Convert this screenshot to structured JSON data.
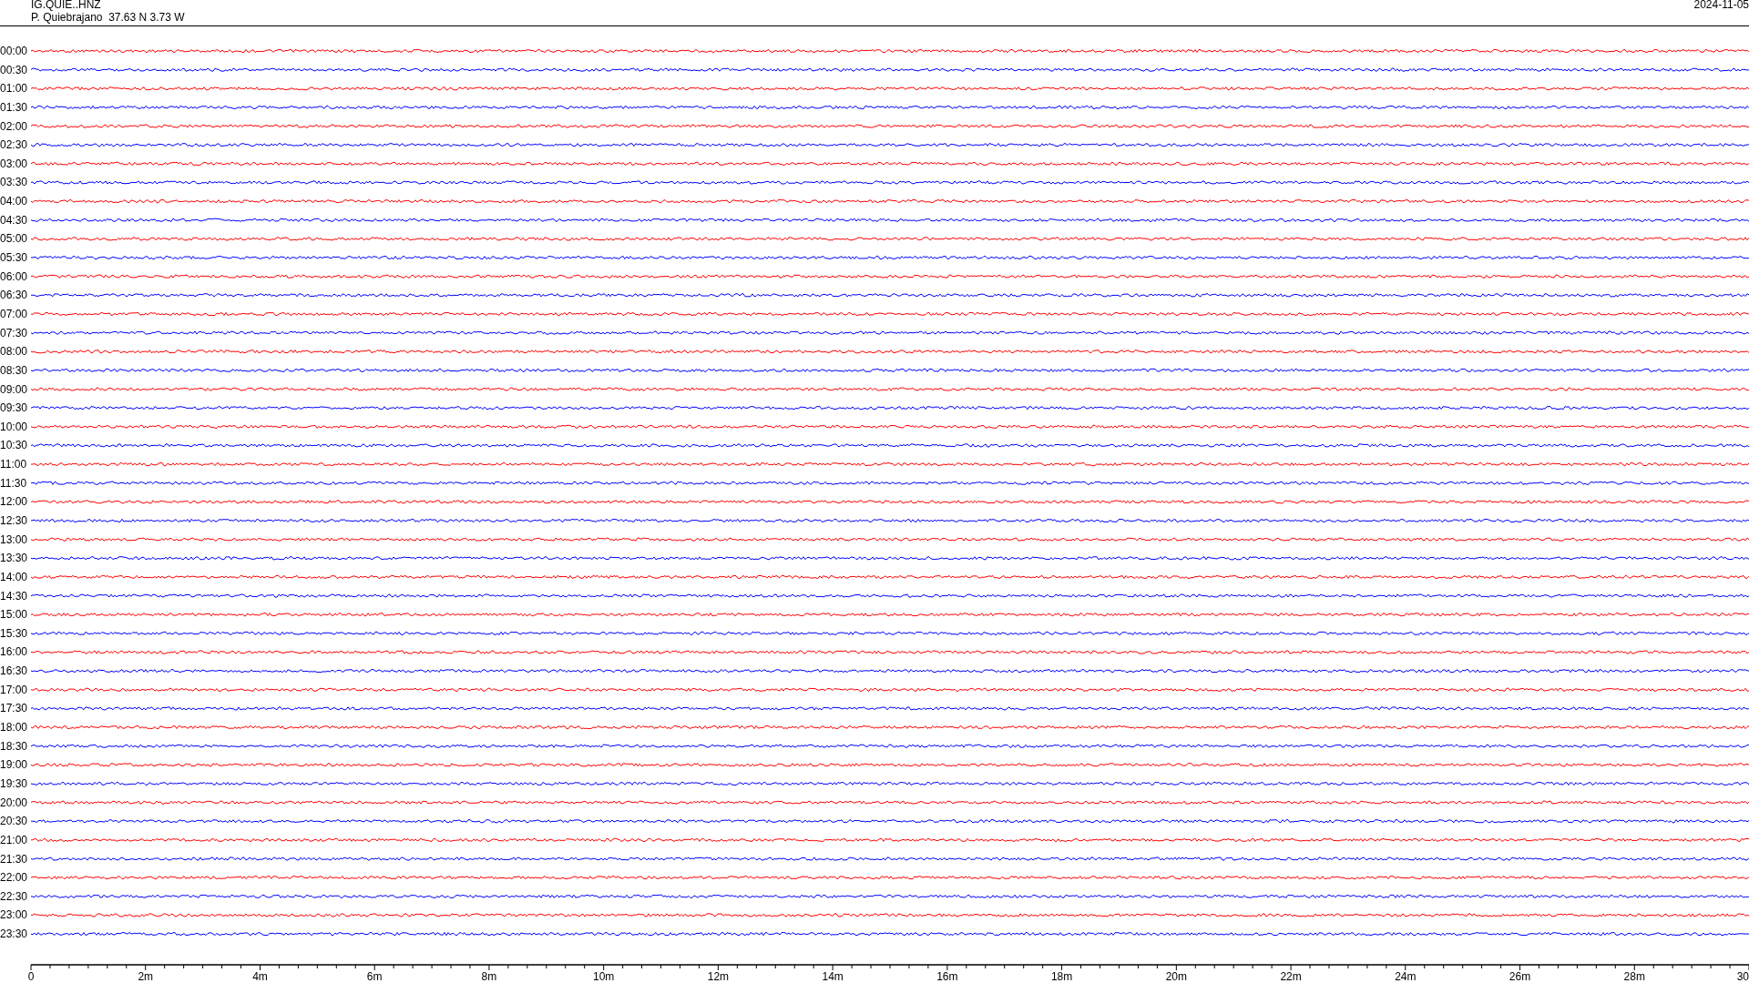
{
  "header": {
    "station": "IG.QUIE..HNZ",
    "location": "P. Quiebrajano  37.63 N 3.73 W",
    "date": "2024-11-05"
  },
  "rows": [
    {
      "label": "00:00",
      "color": "#ff0000"
    },
    {
      "label": "00:30",
      "color": "#0000ff"
    },
    {
      "label": "01:00",
      "color": "#ff0000"
    },
    {
      "label": "01:30",
      "color": "#0000ff"
    },
    {
      "label": "02:00",
      "color": "#ff0000"
    },
    {
      "label": "02:30",
      "color": "#0000ff"
    },
    {
      "label": "03:00",
      "color": "#ff0000"
    },
    {
      "label": "03:30",
      "color": "#0000ff"
    },
    {
      "label": "04:00",
      "color": "#ff0000"
    },
    {
      "label": "04:30",
      "color": "#0000ff"
    },
    {
      "label": "05:00",
      "color": "#ff0000"
    },
    {
      "label": "05:30",
      "color": "#0000ff"
    },
    {
      "label": "06:00",
      "color": "#ff0000"
    },
    {
      "label": "06:30",
      "color": "#0000ff"
    },
    {
      "label": "07:00",
      "color": "#ff0000"
    },
    {
      "label": "07:30",
      "color": "#0000ff"
    },
    {
      "label": "08:00",
      "color": "#ff0000"
    },
    {
      "label": "08:30",
      "color": "#0000ff"
    },
    {
      "label": "09:00",
      "color": "#ff0000"
    },
    {
      "label": "09:30",
      "color": "#0000ff"
    },
    {
      "label": "10:00",
      "color": "#ff0000"
    },
    {
      "label": "10:30",
      "color": "#0000ff"
    },
    {
      "label": "11:00",
      "color": "#ff0000"
    },
    {
      "label": "11:30",
      "color": "#0000ff"
    },
    {
      "label": "12:00",
      "color": "#ff0000"
    },
    {
      "label": "12:30",
      "color": "#0000ff"
    },
    {
      "label": "13:00",
      "color": "#ff0000"
    },
    {
      "label": "13:30",
      "color": "#0000ff"
    },
    {
      "label": "14:00",
      "color": "#ff0000"
    },
    {
      "label": "14:30",
      "color": "#0000ff"
    },
    {
      "label": "15:00",
      "color": "#ff0000"
    },
    {
      "label": "15:30",
      "color": "#0000ff"
    },
    {
      "label": "16:00",
      "color": "#ff0000"
    },
    {
      "label": "16:30",
      "color": "#0000ff"
    },
    {
      "label": "17:00",
      "color": "#ff0000"
    },
    {
      "label": "17:30",
      "color": "#0000ff"
    },
    {
      "label": "18:00",
      "color": "#ff0000"
    },
    {
      "label": "18:30",
      "color": "#0000ff"
    },
    {
      "label": "19:00",
      "color": "#ff0000"
    },
    {
      "label": "19:30",
      "color": "#0000ff"
    },
    {
      "label": "20:00",
      "color": "#ff0000"
    },
    {
      "label": "20:30",
      "color": "#0000ff"
    },
    {
      "label": "21:00",
      "color": "#ff0000"
    },
    {
      "label": "21:30",
      "color": "#0000ff"
    },
    {
      "label": "22:00",
      "color": "#ff0000"
    },
    {
      "label": "22:30",
      "color": "#0000ff"
    },
    {
      "label": "23:00",
      "color": "#ff0000"
    },
    {
      "label": "23:30",
      "color": "#0000ff"
    }
  ],
  "axis": {
    "labels": [
      "0",
      "2m",
      "4m",
      "6m",
      "8m",
      "10m",
      "12m",
      "14m",
      "16m",
      "18m",
      "20m",
      "22m",
      "24m",
      "26m",
      "28m",
      "30"
    ]
  }
}
